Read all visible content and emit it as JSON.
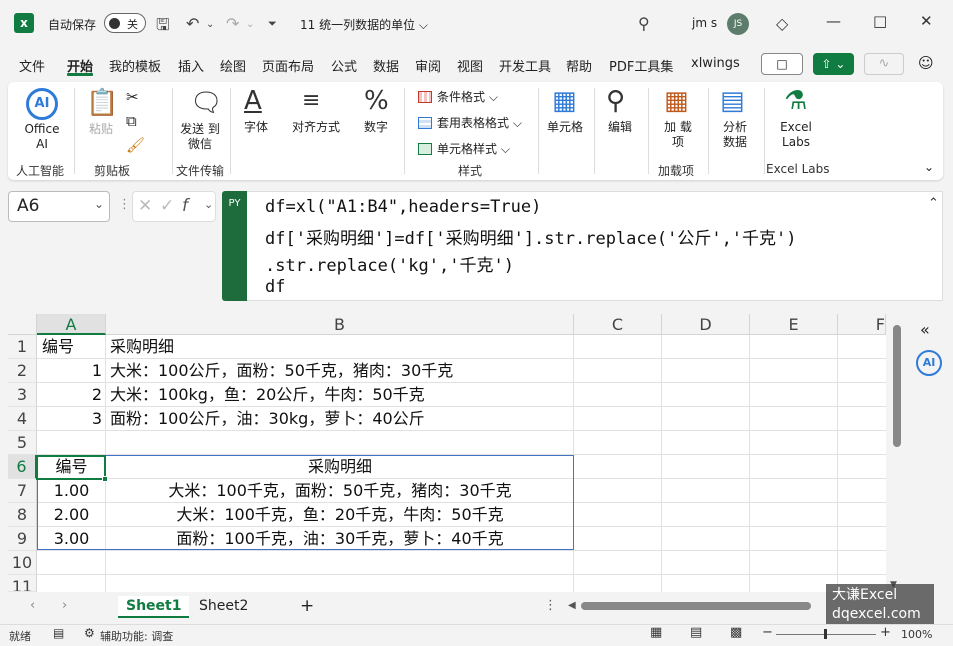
{
  "titlebar": {
    "autosave_label": "自动保存",
    "autosave_state": "关",
    "doc_title": "11 统一列数据的单位 ⌵",
    "user_name": "jm s",
    "avatar_initials": "JS"
  },
  "menu": {
    "tabs": [
      "文件",
      "开始",
      "我的模板",
      "插入",
      "绘图",
      "页面布局",
      "公式",
      "数据",
      "审阅",
      "视图",
      "开发工具",
      "帮助",
      "PDF工具集",
      "xlwings"
    ],
    "active_tab": "开始"
  },
  "ribbon": {
    "office_ai_label": "Office AI",
    "ai_badge": "AI",
    "paste_label": "粘贴",
    "send_wechat_label": "发送 到微信",
    "font_label": "字体",
    "align_label": "对齐方式",
    "number_label": "数字",
    "cond_format_label": "条件格式",
    "table_format_label": "套用表格格式",
    "cell_style_label": "单元格样式",
    "cells_label": "单元格",
    "edit_label": "编辑",
    "addin_label": "加 载项",
    "analyze_label": "分析 数据",
    "excel_labs_label": "Excel Labs",
    "groups": {
      "ai": "人工智能",
      "clipboard": "剪贴板",
      "file_transfer": "文件传输",
      "styles": "样式",
      "addins": "加载项",
      "excel_labs": "Excel Labs"
    }
  },
  "namebox": {
    "value": "A6"
  },
  "formula_bar": {
    "badge": "PY",
    "lines": [
      "df=xl(\"A1:B4\",headers=True)",
      "df['采购明细']=df['采购明细'].str.replace('公斤','千克')",
      ".str.replace('kg','千克')",
      "df"
    ]
  },
  "grid": {
    "columns": [
      "A",
      "B",
      "C",
      "D",
      "E",
      "F"
    ],
    "selected_column": "A",
    "rows": [
      "1",
      "2",
      "3",
      "4",
      "5",
      "6",
      "7",
      "8",
      "9",
      "10",
      "11"
    ],
    "selected_row": "6",
    "source_table": [
      {
        "a": "编号",
        "b": "采购明细"
      },
      {
        "a": "1",
        "b": "大米：100公斤，面粉：50千克，猪肉：30千克"
      },
      {
        "a": "2",
        "b": "大米：100kg，鱼：20公斤，牛肉：50千克"
      },
      {
        "a": "3",
        "b": "面粉：100公斤，油：30kg，萝卜：40公斤"
      }
    ],
    "result_table": [
      {
        "a": "编号",
        "b": "采购明细"
      },
      {
        "a": "1.00",
        "b": "大米：100千克，面粉：50千克，猪肉：30千克"
      },
      {
        "a": "2.00",
        "b": "大米：100千克，鱼：20千克，牛肉：50千克"
      },
      {
        "a": "3.00",
        "b": "面粉：100千克，油：30千克，萝卜：40千克"
      }
    ]
  },
  "sheets": {
    "tabs": [
      "Sheet1",
      "Sheet2"
    ],
    "active": "Sheet1",
    "add": "+"
  },
  "watermark": {
    "line1": "大谦Excel",
    "line2": "dqexcel.com"
  },
  "status": {
    "ready": "就绪",
    "accessibility": "辅助功能: 调查",
    "zoom": "100%"
  },
  "colors": {
    "accent": "#107c41",
    "python": "#1e6b3c",
    "table_border": "#4472c4"
  }
}
